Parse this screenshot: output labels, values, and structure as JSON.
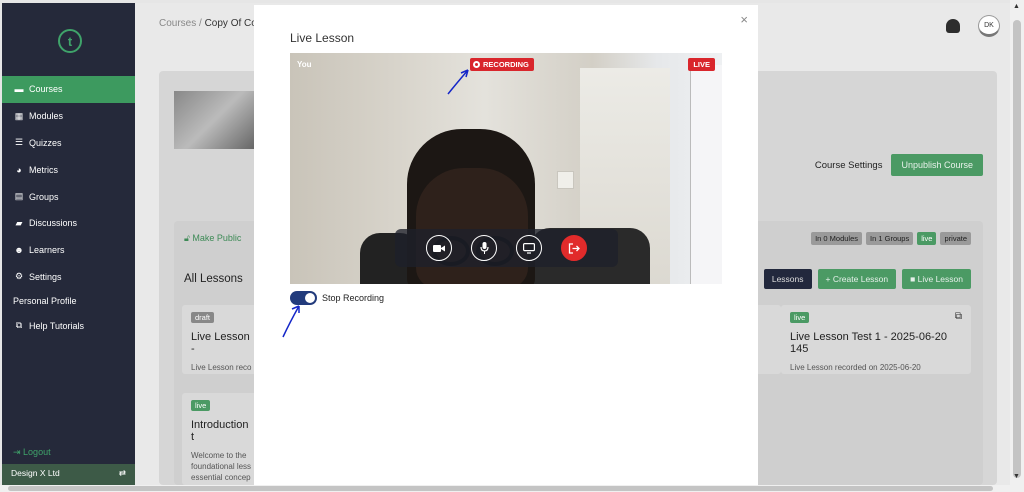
{
  "sidebar": {
    "items": [
      {
        "label": "Courses",
        "icon": "folder-icon"
      },
      {
        "label": "Modules",
        "icon": "grid-icon"
      },
      {
        "label": "Quizzes",
        "icon": "list-icon"
      },
      {
        "label": "Metrics",
        "icon": "chart-icon"
      },
      {
        "label": "Groups",
        "icon": "layers-icon"
      },
      {
        "label": "Discussions",
        "icon": "chat-icon"
      },
      {
        "label": "Learners",
        "icon": "users-icon"
      },
      {
        "label": "Settings",
        "icon": "gear-icon"
      }
    ],
    "personal_profile": "Personal Profile",
    "help": "Help Tutorials",
    "logout": "Logout",
    "org": "Design X Ltd"
  },
  "header": {
    "breadcrumb_root": "Courses /",
    "breadcrumb_current": "Copy Of Co",
    "avatar": "DK"
  },
  "course": {
    "settings_label": "Course Settings",
    "unpublish_label": "Unpublish Course",
    "make_public": "Make Public",
    "badges": [
      "In 0 Modules",
      "In 1 Groups",
      "live",
      "private"
    ],
    "all_lessons": "All Lessons",
    "lessons_btn": "Lessons",
    "create_lesson": "+ Create Lesson",
    "live_lesson": "Live Lesson"
  },
  "lessons": [
    {
      "tag": "draft",
      "title": "Live Lesson -",
      "desc": "Live Lesson reco"
    },
    {
      "tag": "live",
      "title": "Live Lesson Test 1 - 2025-06-20 145",
      "desc": "Live Lesson recorded on 2025-06-20"
    },
    {
      "tag": "live",
      "title": "Introduction t",
      "desc": "Welcome to the foundational less essential concep plumbing system"
    }
  ],
  "modal": {
    "title": "Live Lesson",
    "close": "×",
    "you_label": "You",
    "recording_label": "RECORDING",
    "live_label": "LIVE",
    "toggle_label": "Stop Recording",
    "recording_on": true
  },
  "colors": {
    "sidebar_bg": "#25293a",
    "accent_green": "#3d9a5f",
    "rec_red": "#d9262c",
    "toggle_blue": "#223b7c",
    "annotation_arrow": "#1426c8"
  }
}
